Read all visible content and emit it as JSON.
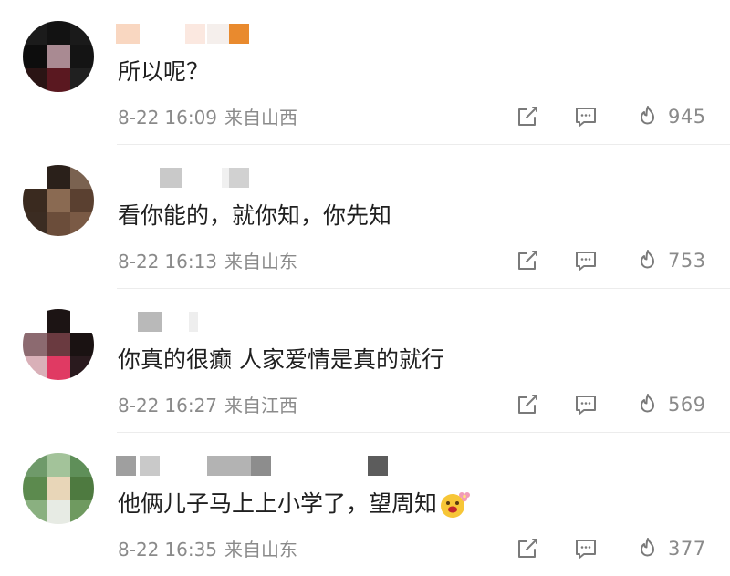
{
  "comments": [
    {
      "text": "所以呢？",
      "date": "8-22",
      "time": "16:09",
      "location": "来自山西",
      "likes": "945",
      "avatar_colors": [
        "#1b1b1b",
        "#121212",
        "#1a1a1a",
        "#0d0d0d",
        "#a98a92",
        "#141414",
        "#2a1414",
        "#5a1820",
        "#202020"
      ],
      "name_colors": [
        "#f9d7c1",
        "#ffffff",
        "#fbe8e0",
        "#f5efec",
        "#e98a2e"
      ]
    },
    {
      "text": "看你能的，就你知，你先知",
      "date": "8-22",
      "time": "16:13",
      "location": "来自山东",
      "likes": "753",
      "avatar_colors": [
        "#ffffff",
        "#2a201a",
        "#7a6250",
        "#3a2a1f",
        "#8a6a52",
        "#5a4030",
        "#3b2c22",
        "#6b4d3a",
        "#7a5a45"
      ],
      "name_colors": [
        "#c9c9c9",
        "#ffffff",
        "#f0f0f0",
        "#d1d1d1",
        "#ffffff"
      ]
    },
    {
      "text": "你真的很癫 人家爱情是真的就行",
      "date": "8-22",
      "time": "16:27",
      "location": "来自江西",
      "likes": "569",
      "avatar_colors": [
        "#ffffff",
        "#1c1414",
        "#ffffff",
        "#8c6a70",
        "#6a3a40",
        "#1a1212",
        "#d9b0b8",
        "#e03a63",
        "#2a1a1e"
      ],
      "name_colors": [
        "#b9b9b9",
        "#ffffff",
        "#eeeeee",
        "#ffffff",
        "#ffffff"
      ]
    },
    {
      "text": "他俩儿子马上上小学了，望周知",
      "date": "8-22",
      "time": "16:35",
      "location": "来自山东",
      "likes": "377",
      "avatar_colors": [
        "#6f9a6a",
        "#a3c39a",
        "#5f8f59",
        "#5c8a4e",
        "#e8d6b8",
        "#4e7a40",
        "#8ab080",
        "#e7ebe4",
        "#6f9a60"
      ],
      "name_colors": [
        "#9f9f9f",
        "#c9c9c9",
        "#b3b3b3",
        "#8d8d8d",
        "#5c5c5c"
      ]
    }
  ],
  "icons": {
    "share": "share-icon",
    "reply": "comment-icon",
    "like": "flame-like-icon",
    "emoji": "flower-face-emoji"
  },
  "colors": {
    "meta_text": "#8a8a8a",
    "icon_stroke": "#7a7a7a",
    "divider": "#ececec"
  }
}
